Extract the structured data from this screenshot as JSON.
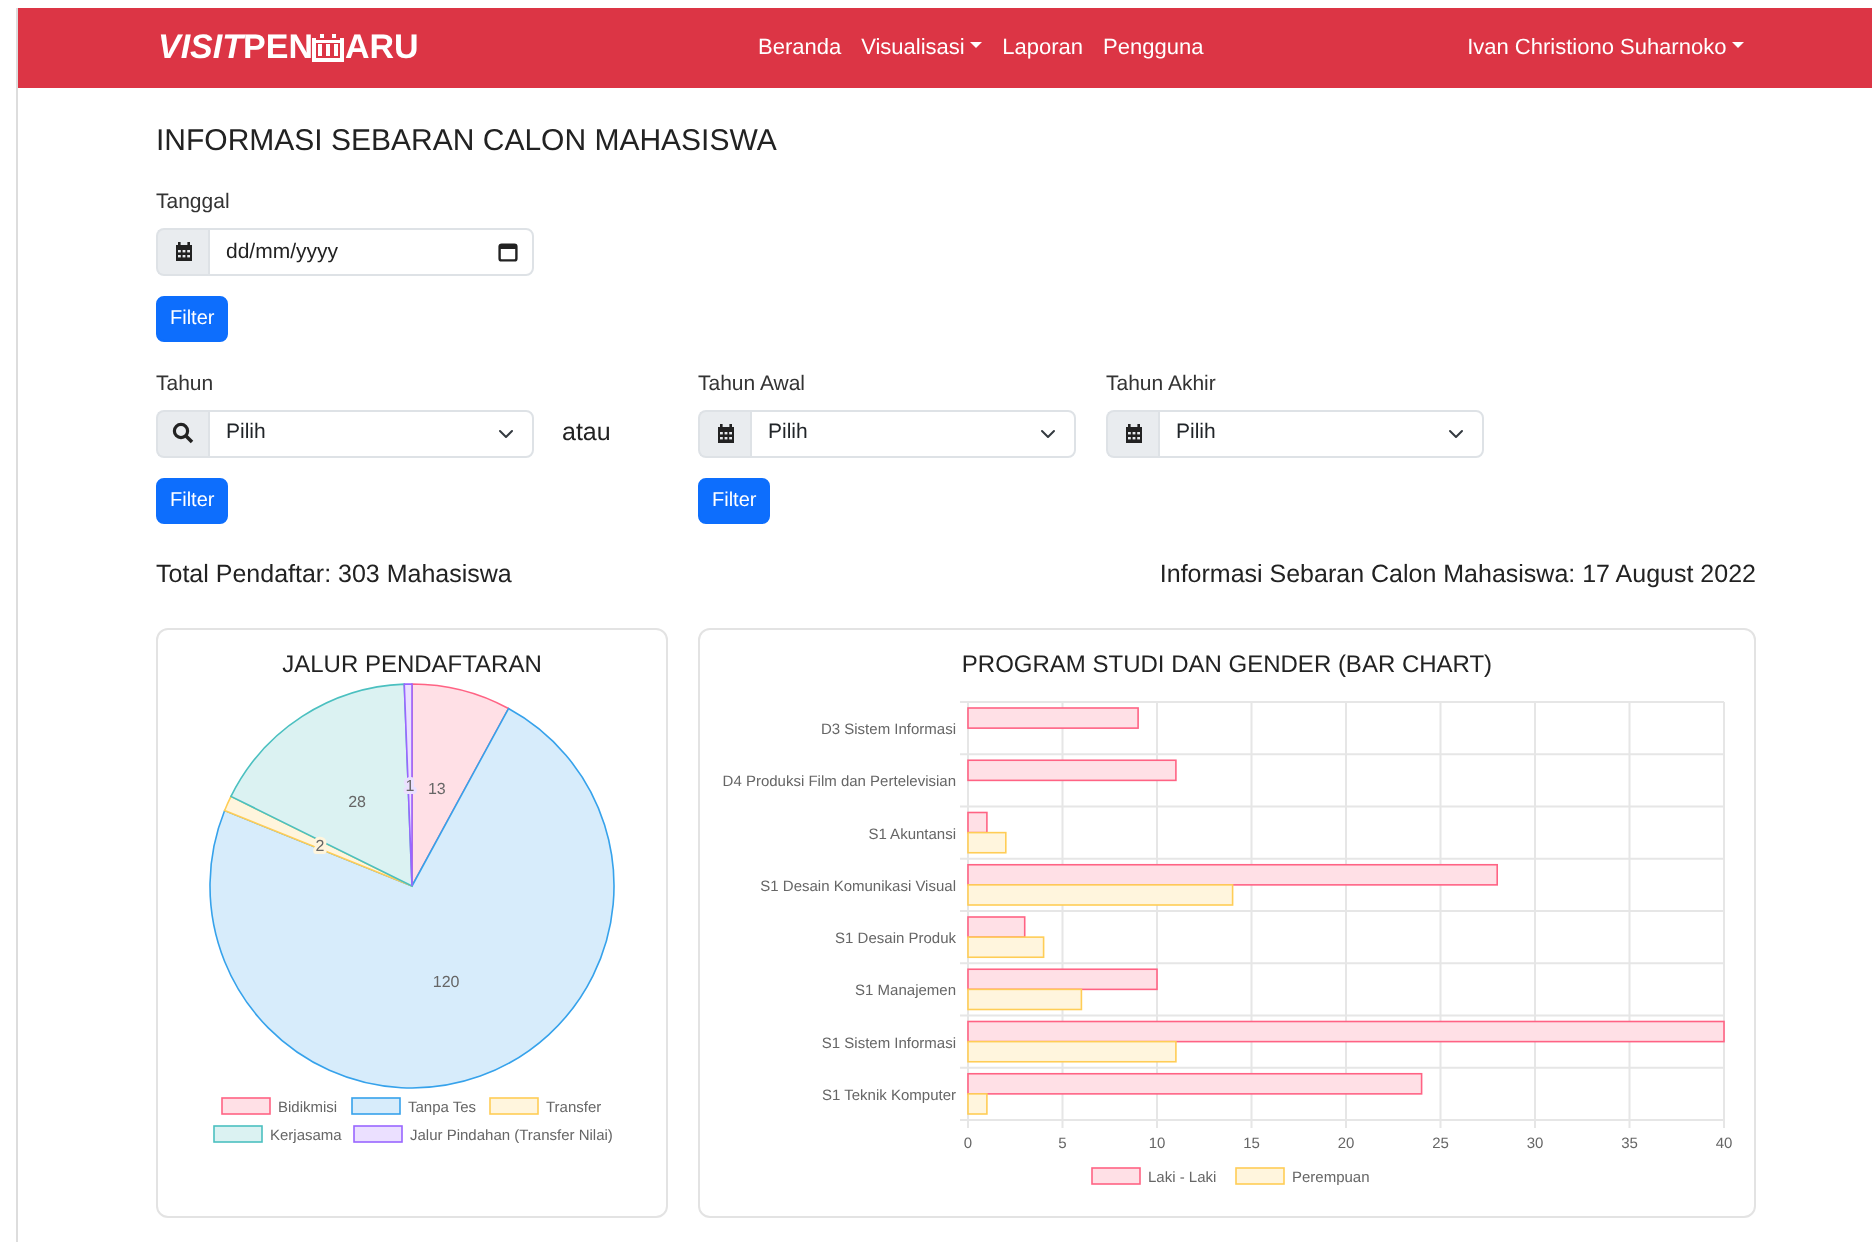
{
  "navbar": {
    "brand": {
      "italic": "VISIT",
      "lead": "PEN",
      "tail": "ARU"
    },
    "links": [
      {
        "label": "Beranda",
        "dropdown": false
      },
      {
        "label": "Visualisasi",
        "dropdown": true
      },
      {
        "label": "Laporan",
        "dropdown": false
      },
      {
        "label": "Pengguna",
        "dropdown": false
      }
    ],
    "user": {
      "label": "Ivan Christiono Suharnoko",
      "dropdown": true
    }
  },
  "title": "INFORMASI SEBARAN CALON MAHASISWA",
  "date_filter": {
    "label": "Tanggal",
    "placeholder": "dd/mm/yyyy",
    "button": "Filter"
  },
  "year_filter": {
    "label": "Tahun",
    "value": "Pilih",
    "button": "Filter"
  },
  "separator": "atau",
  "range_filter": {
    "start": {
      "label": "Tahun Awal",
      "value": "Pilih"
    },
    "end": {
      "label": "Tahun Akhir",
      "value": "Pilih"
    },
    "button": "Filter"
  },
  "total": "Total Pendaftar: 303 Mahasiswa",
  "info": "Informasi Sebaran Calon Mahasiswa: 17 August 2022",
  "pie_card": {
    "chart_data": {
      "type": "pie",
      "title": "JALUR PENDAFTARAN",
      "data_labels": true,
      "legend": true,
      "categories": [
        "Bidikmisi",
        "Tanpa Tes",
        "Transfer",
        "Kerjasama",
        "Jalur Pindahan (Transfer Nilai)"
      ],
      "values": [
        13,
        120,
        2,
        28,
        1
      ],
      "colors": [
        "#ff6384",
        "#36a2eb",
        "#ffcd56",
        "#4bc0c0",
        "#9966ff"
      ]
    }
  },
  "bar_card": {
    "chart_data": {
      "type": "bar",
      "orientation": "horizontal",
      "title": "PROGRAM STUDI DAN GENDER (BAR CHART)",
      "grid": true,
      "legend": true,
      "categories": [
        "D3 Sistem Informasi",
        "D4 Produksi Film dan Pertelevisian",
        "S1 Akuntansi",
        "S1 Desain Komunikasi Visual",
        "S1 Desain Produk",
        "S1 Manajemen",
        "S1 Sistem Informasi",
        "S1 Teknik Komputer"
      ],
      "series": [
        {
          "name": "Laki - Laki",
          "color": "#ff6384",
          "values": [
            9,
            11,
            1,
            28,
            3,
            10,
            40,
            24
          ]
        },
        {
          "name": "Perempuan",
          "color": "#ffcd56",
          "values": [
            0,
            0,
            2,
            14,
            4,
            6,
            11,
            1
          ]
        }
      ],
      "xlim": [
        0,
        40
      ],
      "xticks": [
        0,
        5,
        10,
        15,
        20,
        25,
        30,
        35,
        40
      ]
    }
  }
}
